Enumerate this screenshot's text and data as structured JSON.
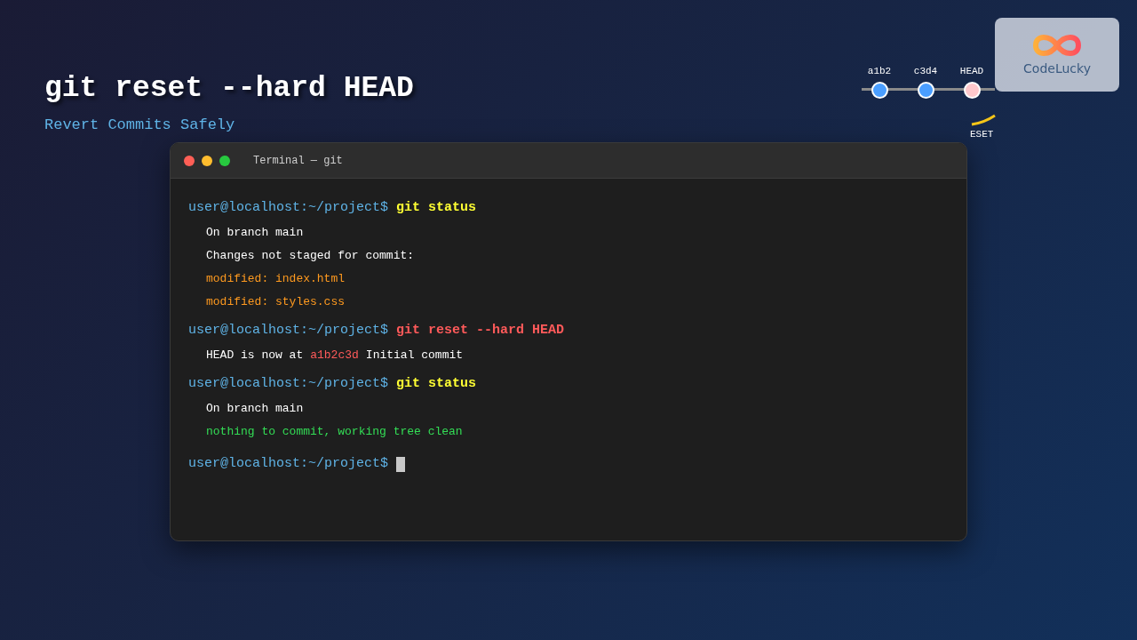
{
  "title": "git reset --hard HEAD",
  "subtitle": "Revert Commits Safely",
  "timeline": {
    "nodes": [
      {
        "label": "a1b2",
        "color": "#4a9eff"
      },
      {
        "label": "c3d4",
        "color": "#4a9eff"
      },
      {
        "label": "HEAD",
        "color": "#ffc8cc"
      }
    ],
    "arrow_label": "ESET"
  },
  "logo": {
    "text": "CodeLucky"
  },
  "terminal": {
    "title": "Terminal — git",
    "lines": [
      {
        "kind": "prompt",
        "prompt": "user@localhost:~/project$",
        "command": "git status",
        "color": "#ffff33"
      },
      {
        "kind": "output",
        "segments": [
          {
            "text": "On branch main",
            "color": "#ffffff"
          }
        ]
      },
      {
        "kind": "output",
        "segments": [
          {
            "text": "Changes not staged for commit:",
            "color": "#ffffff"
          }
        ]
      },
      {
        "kind": "output",
        "segments": [
          {
            "text": "modified: index.html",
            "color": "#ff9a1f"
          }
        ]
      },
      {
        "kind": "output",
        "segments": [
          {
            "text": "modified: styles.css",
            "color": "#ff9a1f"
          }
        ]
      },
      {
        "kind": "prompt",
        "prompt": "user@localhost:~/project$",
        "command": "git reset --hard HEAD",
        "color": "#ff5a5a"
      },
      {
        "kind": "output",
        "segments": [
          {
            "text": "HEAD is now at",
            "color": "#ffffff"
          },
          {
            "text": "a1b2c3d",
            "color": "#ff5a5a"
          },
          {
            "text": "Initial commit",
            "color": "#ffffff"
          }
        ]
      },
      {
        "kind": "prompt",
        "prompt": "user@localhost:~/project$",
        "command": "git status",
        "color": "#ffff33"
      },
      {
        "kind": "output",
        "segments": [
          {
            "text": "On branch main",
            "color": "#ffffff"
          }
        ]
      },
      {
        "kind": "output",
        "segments": [
          {
            "text": "nothing to commit, working tree clean",
            "color": "#33dd55"
          }
        ]
      },
      {
        "kind": "cursor",
        "prompt": "user@localhost:~/project$"
      }
    ]
  }
}
